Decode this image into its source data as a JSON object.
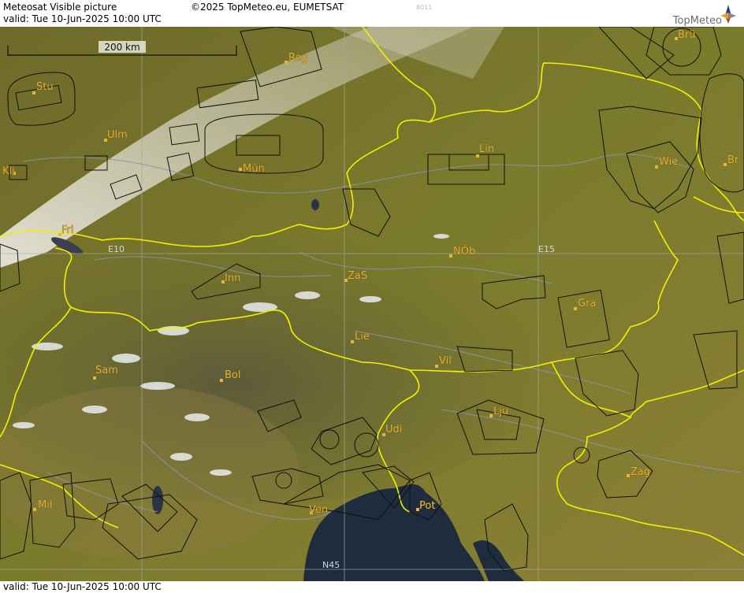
{
  "header": {
    "title": "Meteosat Visible picture",
    "valid_line": "valid:  Tue  10-Jun-2025  10:00 UTC",
    "copyright": "©2025 TopMeteo.eu, EUMETSAT",
    "faint_id": "8011",
    "logo_text": "TopMeteo"
  },
  "footer": {
    "valid_line": "valid:  Tue  10-Jun-2025  10:00 UTC"
  },
  "scale": {
    "label": "200 km"
  },
  "grid_labels": {
    "lon_e10": "E10",
    "lon_e15": "E15",
    "lat_n45": "N45"
  },
  "cities": [
    {
      "name": "Brü"
    },
    {
      "name": "Reg"
    },
    {
      "name": "Stu"
    },
    {
      "name": "Ulm"
    },
    {
      "name": "Lin"
    },
    {
      "name": "Wie"
    },
    {
      "name": "Br"
    },
    {
      "name": "Kli"
    },
    {
      "name": "Mün"
    },
    {
      "name": "Fri"
    },
    {
      "name": "NÖb"
    },
    {
      "name": "Inn"
    },
    {
      "name": "ZaS"
    },
    {
      "name": "Gra"
    },
    {
      "name": "Lie"
    },
    {
      "name": "Vil"
    },
    {
      "name": "Sam"
    },
    {
      "name": "Bol"
    },
    {
      "name": "Lju"
    },
    {
      "name": "Udi"
    },
    {
      "name": "Zag"
    },
    {
      "name": "Mil"
    },
    {
      "name": "Ven"
    },
    {
      "name": "Pot"
    }
  ],
  "colors": {
    "land": "#7a7a2a",
    "alps": "#6e6a3a",
    "sea": "#1e2a3a",
    "border": "#f2f000",
    "river": "#8a94b0",
    "airspace": "#111111",
    "city": "#e8b33a"
  },
  "icons": {
    "logo": "topmeteo-compass-logo"
  }
}
